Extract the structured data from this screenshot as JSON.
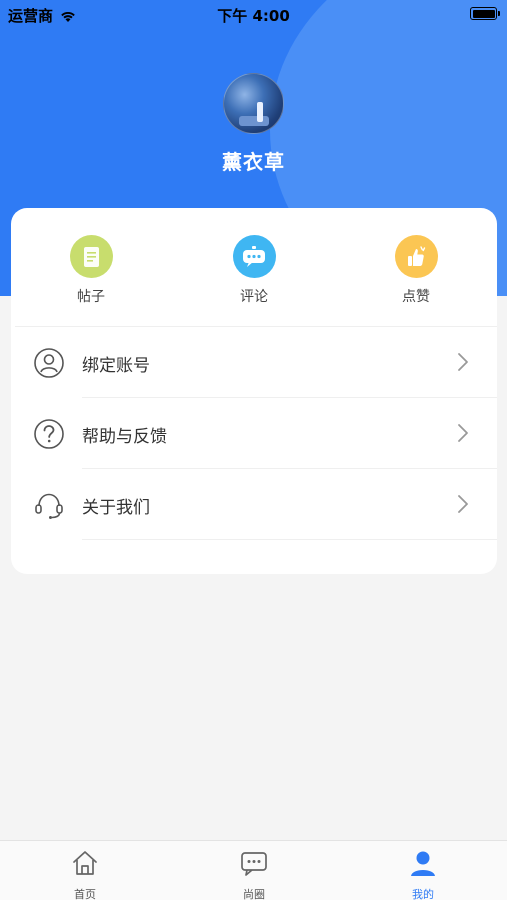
{
  "status_bar": {
    "carrier": "运营商",
    "time": "下午 4:00"
  },
  "profile": {
    "username": "薰衣草"
  },
  "stats": [
    {
      "label": "帖子",
      "icon": "note-icon",
      "color": "#c8dd6d"
    },
    {
      "label": "评论",
      "icon": "chat-bubble-icon",
      "color": "#3fb6f2"
    },
    {
      "label": "点赞",
      "icon": "thumbs-up-icon",
      "color": "#fbc653"
    }
  ],
  "menu": [
    {
      "label": "绑定账号",
      "icon": "user-circle-icon"
    },
    {
      "label": "帮助与反馈",
      "icon": "question-circle-icon"
    },
    {
      "label": "关于我们",
      "icon": "headset-icon"
    }
  ],
  "tabbar": {
    "home": "首页",
    "circle": "尚圈",
    "mine": "我的",
    "active": "mine"
  },
  "colors": {
    "primary": "#2f7bf4",
    "background": "#f4f4f4"
  }
}
